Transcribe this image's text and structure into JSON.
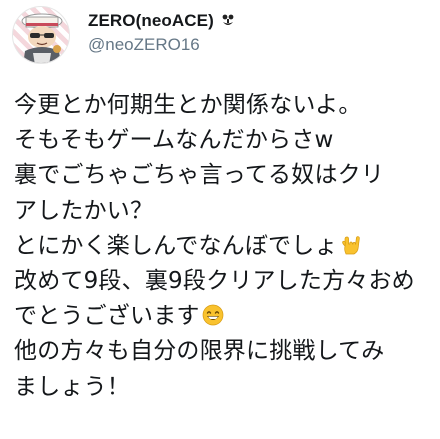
{
  "tweet": {
    "author": {
      "display_name": "ZERO(neoACE)",
      "display_name_emoji": "gang-sign-emoji-icon",
      "username": "@neoZERO16"
    },
    "lines": [
      "今更とか何期生とか関係ないよ。",
      "そもそもゲームなんだからさw",
      "裏でごちゃごちゃ言ってる奴はクリ",
      "アしたかい？",
      "とにかく楽しんでなんぼでしょ",
      "改めて9段、裏9段クリアした方々おめ",
      "でとうございます",
      "他の方々も自分の限界に挑戦してみ",
      "ましょう！"
    ],
    "emojis": {
      "rock_hand": "sign-of-horns-emoji-icon",
      "grin": "grinning-face-emoji-icon"
    }
  },
  "colors": {
    "text": "#14171a",
    "secondary_text": "#657786",
    "emoji_yellow": "#f9c22e"
  }
}
